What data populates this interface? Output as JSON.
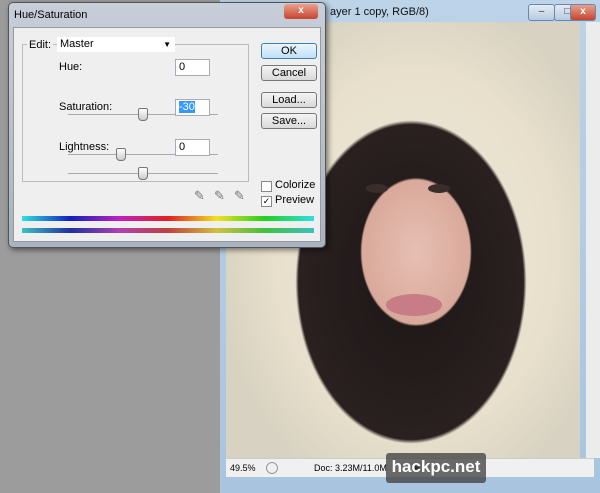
{
  "document": {
    "title": "ayer 1 copy, RGB/8)",
    "zoom": "49.5%",
    "doc_info": "Doc: 3.23M/11.0M",
    "minimize": "–",
    "maximize": "□",
    "close": "x"
  },
  "watermark": "hackpc.net",
  "dialog": {
    "title": "Hue/Saturation",
    "close": "x",
    "edit_label": "Edit:",
    "edit_value": "Master",
    "hue_label": "Hue:",
    "hue_value": "0",
    "hue_pct": 50,
    "saturation_label": "Saturation:",
    "saturation_value": "-30",
    "saturation_pct": 35,
    "lightness_label": "Lightness:",
    "lightness_value": "0",
    "lightness_pct": 50,
    "ok": "OK",
    "cancel": "Cancel",
    "load": "Load...",
    "save": "Save...",
    "colorize_label": "Colorize",
    "colorize_checked": false,
    "preview_label": "Preview",
    "preview_checked": true
  }
}
